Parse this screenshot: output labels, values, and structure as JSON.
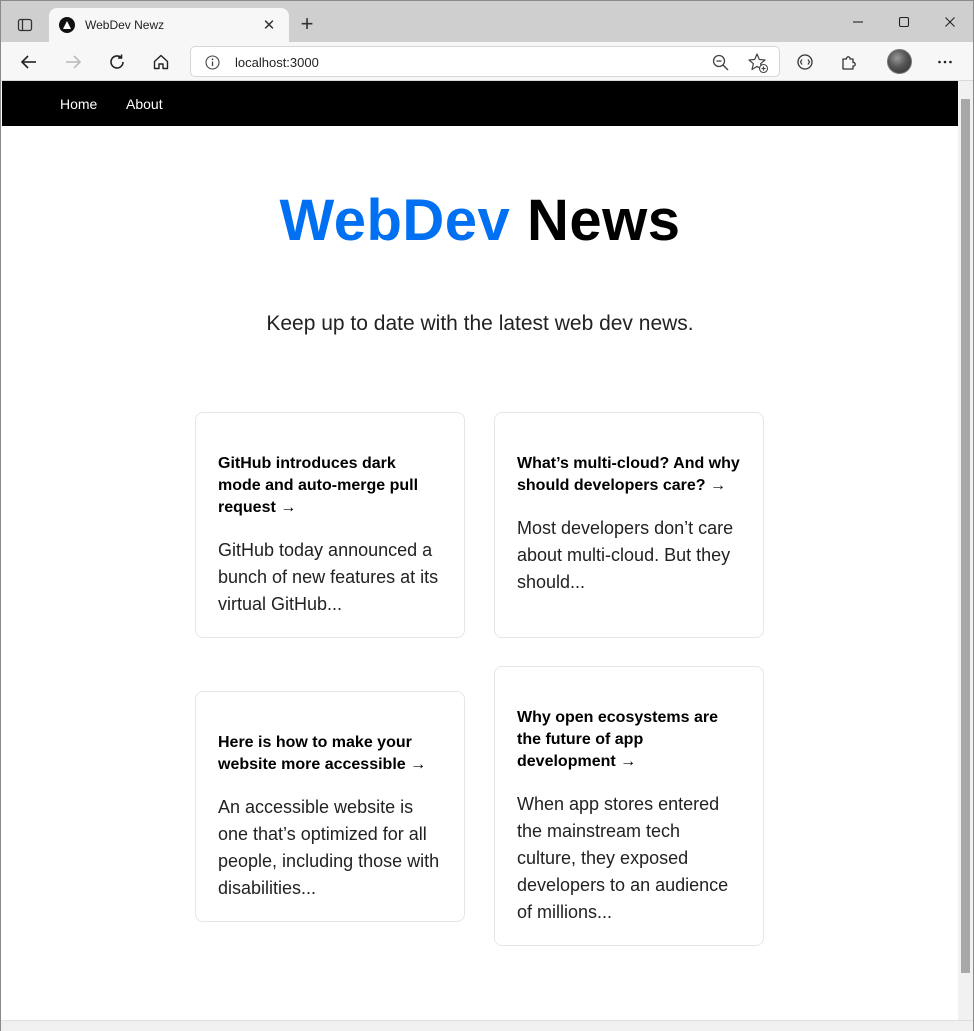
{
  "browser": {
    "tab_title": "WebDev Newz",
    "tab_close_glyph": "✕",
    "new_tab_glyph": "+",
    "url": "localhost:3000",
    "window_controls": {
      "minimize": "—",
      "maximize": "☐",
      "close": "✕"
    },
    "icons": [
      "tab-actions-icon",
      "back-icon",
      "forward-icon",
      "reload-icon",
      "home-icon",
      "site-info-icon",
      "zoom-out-icon",
      "add-favorite-icon",
      "browser-essentials-icon",
      "extensions-icon",
      "profile-avatar",
      "more-menu-icon"
    ]
  },
  "nav": {
    "links": [
      {
        "label": "Home"
      },
      {
        "label": "About"
      }
    ]
  },
  "hero": {
    "title_accent": "WebDev",
    "title_rest": "News",
    "subtitle": "Keep up to date with the latest web dev news."
  },
  "articles": [
    {
      "title": "GitHub introduces dark mode and auto-merge pull request →",
      "excerpt": "GitHub today announced a bunch of new features at its virtual GitHub..."
    },
    {
      "title": "What’s multi-cloud? And why should developers care? →",
      "excerpt": "Most developers don’t care about multi-cloud. But they should..."
    },
    {
      "title": "Here is how to make your website more accessible →",
      "excerpt": "An accessible website is one that’s optimized for all people, including those with disabilities..."
    },
    {
      "title": "Why open ecosystems are the future of app development →",
      "excerpt": "When app stores entered the mainstream tech culture, they exposed developers to an audience of millions..."
    }
  ],
  "colors": {
    "accent": "#0070f3",
    "navbar": "#000000",
    "tabstrip": "#cfcfcf"
  }
}
